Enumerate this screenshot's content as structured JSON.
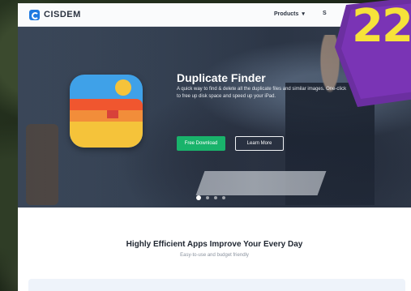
{
  "brand": {
    "name": "CISDEM"
  },
  "nav": {
    "products_label": "Products",
    "products_chevron": "chevron-down-icon",
    "truncated_label": "S"
  },
  "hero": {
    "title": "Duplicate Finder",
    "description": "A quick way to find & delete all the duplicate files and similar images. One-click to free up disk space and speed up your iPad.",
    "download_label": "Free Download",
    "learn_label": "Learn More",
    "slides": 4,
    "active_slide": 1
  },
  "section": {
    "title": "Highly Efficient Apps Improve Your Every Day",
    "subtitle": "Easy-to-use and budget friendly"
  },
  "badge": {
    "text": "22"
  },
  "colors": {
    "accent_green": "#19b36b",
    "brand_blue": "#1f7ae0",
    "badge_purple": "#6b2fa0",
    "badge_yellow": "#f6e23a"
  }
}
